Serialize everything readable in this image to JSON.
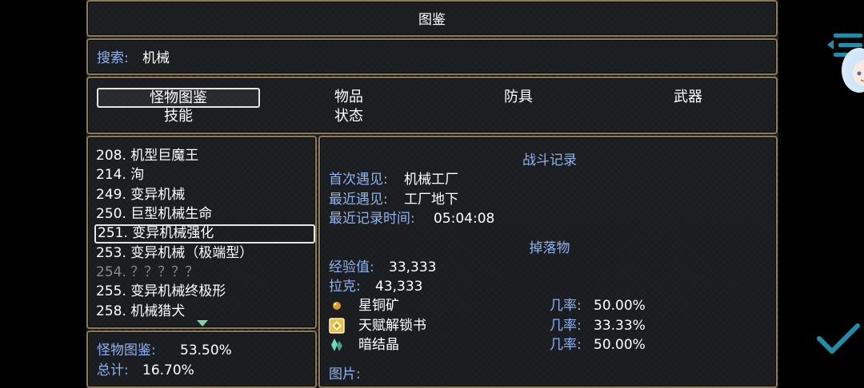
{
  "title": "图鉴",
  "search": {
    "label": "搜索:",
    "value": "机械"
  },
  "categories": [
    "怪物图鉴",
    "物品",
    "防具",
    "武器",
    "技能",
    "状态"
  ],
  "selected_category": "怪物图鉴",
  "list": [
    {
      "text": "208. 机型巨魔王",
      "known": true
    },
    {
      "text": "214. 洵",
      "known": true
    },
    {
      "text": "249. 变异机械",
      "known": true
    },
    {
      "text": "250. 巨型机械生命",
      "known": true
    },
    {
      "text": "251. 变异机械强化",
      "known": true,
      "selected": true
    },
    {
      "text": "253. 变异机械（极端型）",
      "known": true
    },
    {
      "text": "254. ？？？？？",
      "known": false
    },
    {
      "text": "255. 变异机械终极形",
      "known": true
    },
    {
      "text": "258. 机械猎犬",
      "known": true
    }
  ],
  "progress": {
    "monster_label": "怪物图鉴:",
    "monster_value": "53.50%",
    "total_label": "总计:",
    "total_value": "16.70%"
  },
  "battle_record": {
    "heading": "战斗记录",
    "first_seen_label": "首次遇见:",
    "first_seen_value": "机械工厂",
    "last_seen_label": "最近遇见:",
    "last_seen_value": "工厂地下",
    "last_time_label": "最近记录时间:",
    "last_time_value": "05:04:08"
  },
  "drops": {
    "heading": "掉落物",
    "exp_label": "经验值:",
    "exp_value": "33,333",
    "gold_label": "拉克:",
    "gold_value": "43,333",
    "items": [
      {
        "name": "星铜矿",
        "rate_label": "几率:",
        "rate": "50.00%",
        "icon": "ore-orb-icon"
      },
      {
        "name": "天赋解锁书",
        "rate_label": "几率:",
        "rate": "33.33%",
        "icon": "talent-book-icon"
      },
      {
        "name": "暗结晶",
        "rate_label": "几率:",
        "rate": "50.00%",
        "icon": "crystal-icon"
      }
    ]
  },
  "image_label": "图片:",
  "colors": {
    "label_blue": "#8fb3f0",
    "frame": "#8a7a58",
    "unknown": "#8a8a8a"
  }
}
